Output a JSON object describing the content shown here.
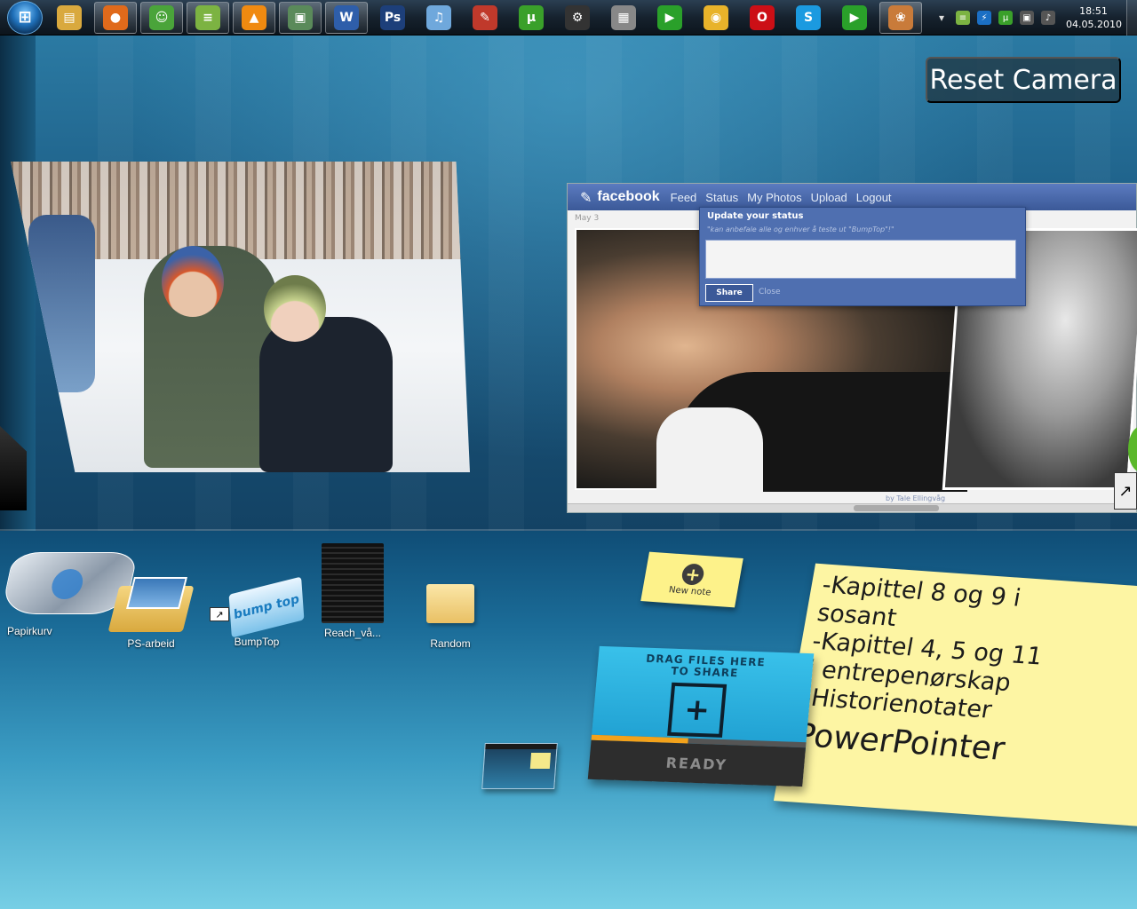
{
  "taskbar": {
    "start_label": "⊞",
    "apps": [
      {
        "name": "explorer",
        "glyph": "▤",
        "color": "#d9a93e",
        "active": false
      },
      {
        "name": "firefox",
        "glyph": "●",
        "color": "#e06a1b",
        "active": true
      },
      {
        "name": "messenger",
        "glyph": "☺",
        "color": "#4aa43a",
        "active": true
      },
      {
        "name": "spotify",
        "glyph": "≡",
        "color": "#7cb342",
        "active": true
      },
      {
        "name": "vlc",
        "glyph": "▲",
        "color": "#f08a10",
        "active": true
      },
      {
        "name": "tasks",
        "glyph": "▣",
        "color": "#5a8a5a",
        "active": true
      },
      {
        "name": "word",
        "glyph": "W",
        "color": "#2e5eaa",
        "active": true
      },
      {
        "name": "photoshop",
        "glyph": "Ps",
        "color": "#1d3f7a",
        "active": false
      },
      {
        "name": "itunes",
        "glyph": "♫",
        "color": "#6fa8dc",
        "active": false
      },
      {
        "name": "paint",
        "glyph": "✎",
        "color": "#c0392b",
        "active": false
      },
      {
        "name": "utorrent",
        "glyph": "µ",
        "color": "#3aa02a",
        "active": false
      },
      {
        "name": "steam",
        "glyph": "⚙",
        "color": "#333333",
        "active": false
      },
      {
        "name": "media",
        "glyph": "▦",
        "color": "#888888",
        "active": false
      },
      {
        "name": "play",
        "glyph": "▶",
        "color": "#2aa02a",
        "active": false
      },
      {
        "name": "chrome",
        "glyph": "◉",
        "color": "#e8b32a",
        "active": false
      },
      {
        "name": "opera",
        "glyph": "O",
        "color": "#cc0f16",
        "active": false
      },
      {
        "name": "skype",
        "glyph": "S",
        "color": "#1b9ae0",
        "active": false
      },
      {
        "name": "play2",
        "glyph": "▶",
        "color": "#2aa02a",
        "active": false
      },
      {
        "name": "bumptop",
        "glyph": "❀",
        "color": "#c97b3a",
        "active": true
      }
    ],
    "tray": {
      "expand": "▾",
      "icons": [
        {
          "name": "spotify-tray",
          "glyph": "≡",
          "color": "#7cb342"
        },
        {
          "name": "flash-tray",
          "glyph": "⚡",
          "color": "#1b6fc4"
        },
        {
          "name": "utorrent-tray",
          "glyph": "µ",
          "color": "#3aa02a"
        },
        {
          "name": "network-tray",
          "glyph": "▣",
          "color": "#555555"
        },
        {
          "name": "volume-tray",
          "glyph": "♪",
          "color": "#555555"
        }
      ],
      "time": "18:51",
      "date": "04.05.2010"
    }
  },
  "reset_camera": "Reset Camera",
  "facebook": {
    "logo": "facebook",
    "nav": [
      "Feed",
      "Status",
      "My Photos",
      "Upload",
      "Logout"
    ],
    "date": "May 3",
    "popup_title": "Update your status",
    "popup_hint": "\"kan anbefale alle og enhver å teste ut \"BumpTop\"!\"",
    "share_label": "Share",
    "close_label": "Close",
    "credit": "by Tale Ellingvåg"
  },
  "desktop_icons": {
    "recycle_bin": "Papirkurv",
    "ps_folder": "PS-arbeid",
    "bumptop": "BumpTop",
    "bumptop_tile_text": "bump top",
    "reach_pile": "Reach_vå...",
    "random_folder": "Random"
  },
  "new_note": {
    "label": "New note",
    "icon": "+"
  },
  "sticky_note": {
    "lines": [
      "-Kapittel 8 og 9 i",
      "sosant",
      "-Kapittel 4, 5 og 11",
      "i entrepenørskap",
      "-Historienotater",
      "PowerPointer"
    ]
  },
  "share_widget": {
    "title_line1": "DRAG FILES HERE",
    "title_line2": "TO SHARE",
    "icon": "+",
    "status": "READY",
    "progress": 0.45,
    "progress_color": "#f3a21b"
  },
  "shortcut_arrow": "↗"
}
